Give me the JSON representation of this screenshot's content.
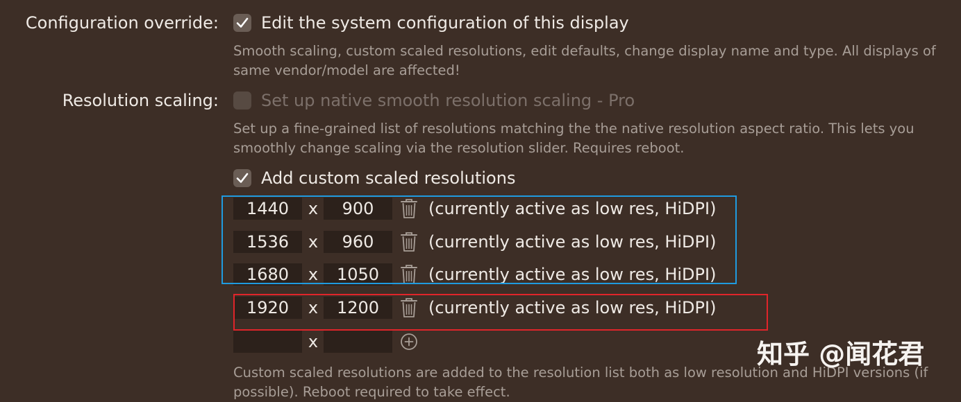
{
  "config_override": {
    "label": "Configuration override:",
    "checkbox_label": "Edit the system configuration of this display",
    "checked": true,
    "description": "Smooth scaling, custom scaled resolutions, edit defaults, change display name and type. All displays of same vendor/model are affected!"
  },
  "resolution_scaling": {
    "label": "Resolution scaling:",
    "native_checkbox_label": "Set up native smooth resolution scaling - Pro",
    "native_checked": false,
    "native_enabled": false,
    "native_description": "Set up a fine-grained list of resolutions matching the the native resolution aspect ratio. This lets you smoothly change scaling via the resolution slider. Requires reboot.",
    "custom_checkbox_label": "Add custom scaled resolutions",
    "custom_checked": true,
    "times_symbol": "x",
    "resolutions": [
      {
        "width": "1440",
        "height": "900",
        "status": "(currently active as low res, HiDPI)"
      },
      {
        "width": "1536",
        "height": "960",
        "status": "(currently active as low res, HiDPI)"
      },
      {
        "width": "1680",
        "height": "1050",
        "status": "(currently active as low res, HiDPI)"
      },
      {
        "width": "1920",
        "height": "1200",
        "status": "(currently active as low res, HiDPI)"
      }
    ],
    "new_resolution": {
      "width": "",
      "height": ""
    },
    "footer_description": "Custom scaled resolutions are added to the resolution list both as low resolution and HiDPI versions (if possible). Reboot required to take effect."
  },
  "highlights": {
    "blue_color": "#1f9be0",
    "red_color": "#e0252a"
  },
  "watermark": "知乎 @闻花君",
  "icons": {
    "checkmark": "checkmark-icon",
    "trash": "trash-icon",
    "add": "plus-circle-icon"
  }
}
